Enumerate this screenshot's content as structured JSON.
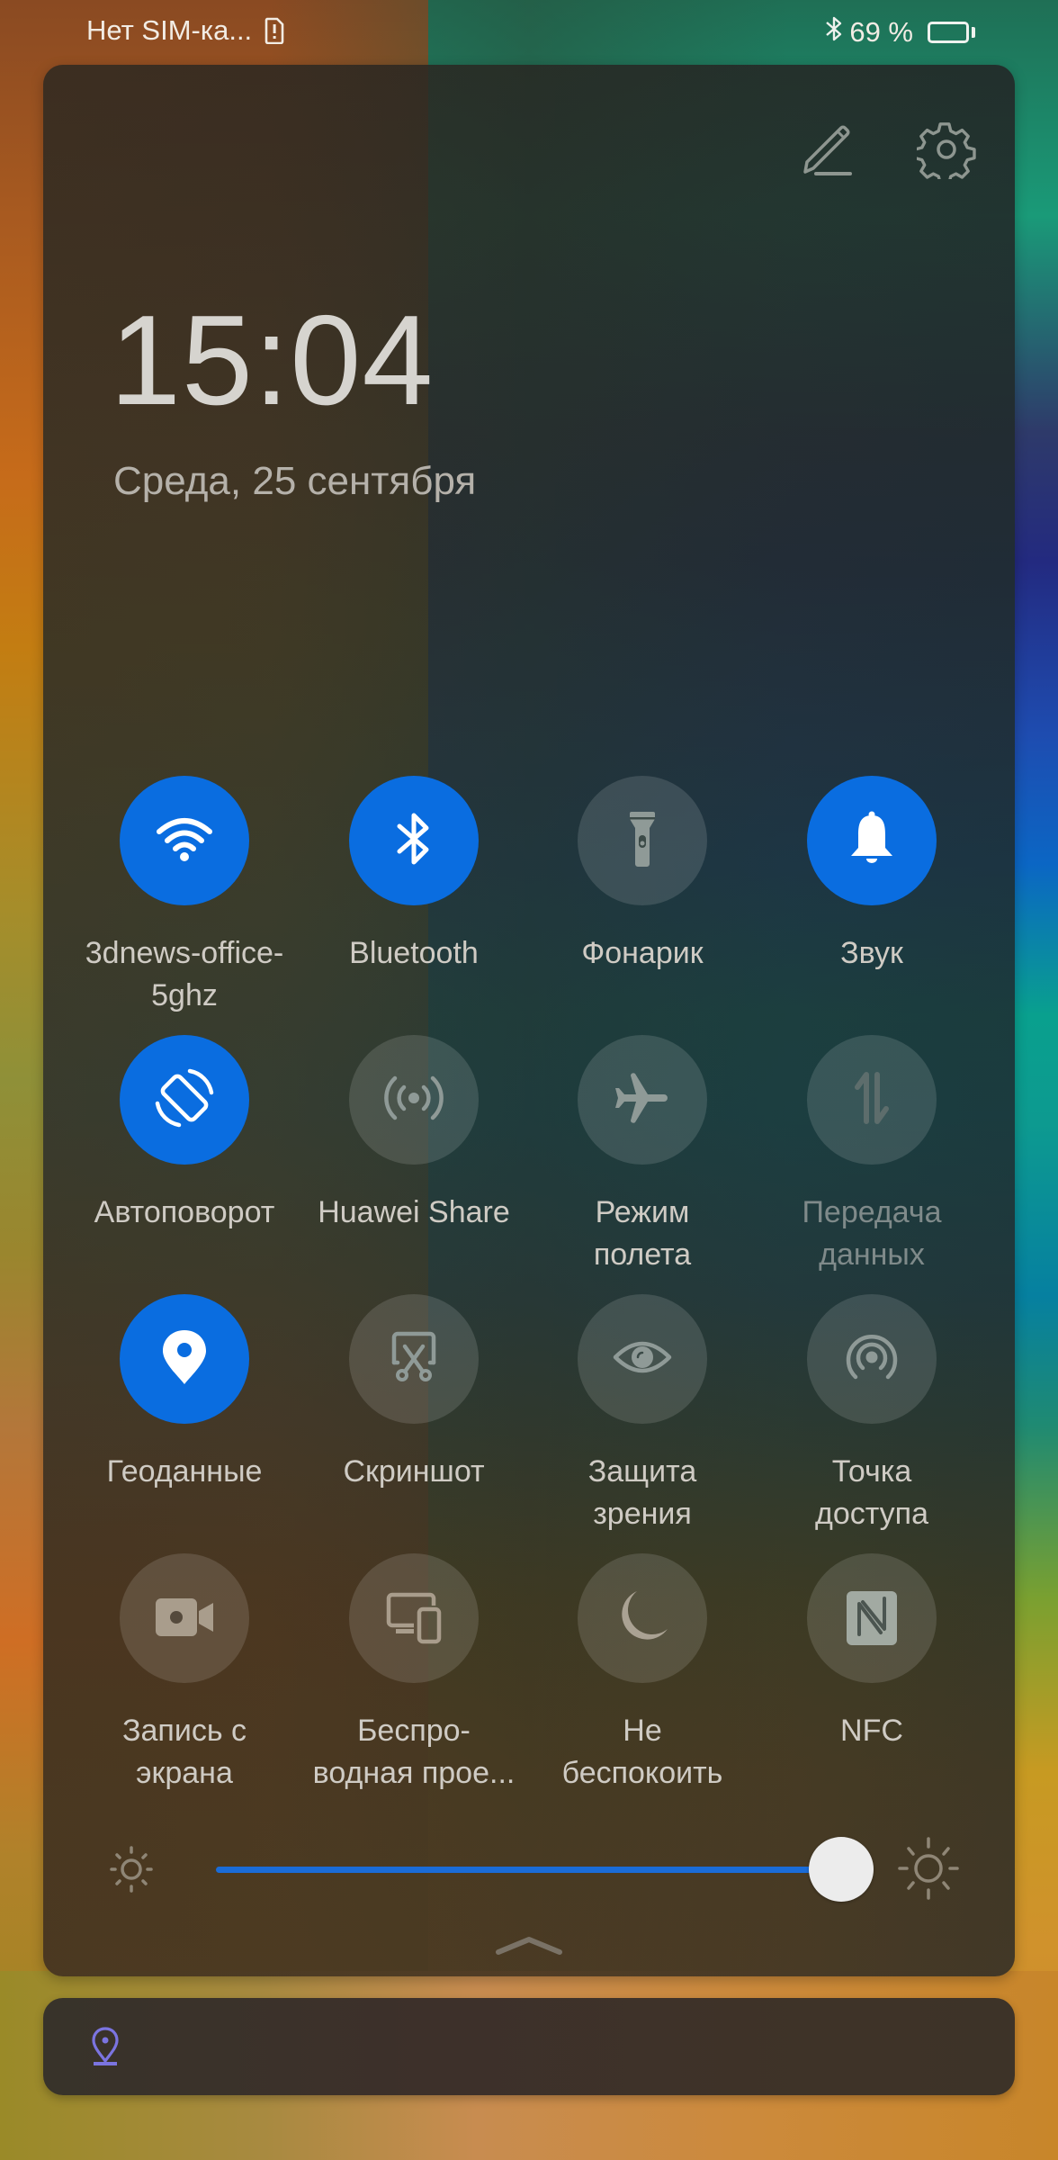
{
  "status_bar": {
    "carrier_text": "Нет SIM-ка...",
    "sim_icon": "sim-alert-icon",
    "bluetooth_icon": "bluetooth-icon",
    "battery_percent_text": "69 %",
    "battery_level": 0.69
  },
  "header": {
    "edit_icon": "pencil-edit-icon",
    "settings_icon": "gear-icon"
  },
  "clock": {
    "time": "15:04",
    "date": "Среда, 25 сентября"
  },
  "tiles": [
    {
      "label": "3dnews-office-\n5ghz",
      "icon": "wifi-icon",
      "state": "on"
    },
    {
      "label": "Bluetooth",
      "icon": "bluetooth-icon",
      "state": "on"
    },
    {
      "label": "Фонарик",
      "icon": "flashlight-icon",
      "state": "off"
    },
    {
      "label": "Звук",
      "icon": "bell-icon",
      "state": "on"
    },
    {
      "label": "Автоповорот",
      "icon": "auto-rotate-icon",
      "state": "on"
    },
    {
      "label": "Huawei Share",
      "icon": "huawei-share-icon",
      "state": "off"
    },
    {
      "label": "Режим\nполета",
      "icon": "airplane-icon",
      "state": "off"
    },
    {
      "label": "Передача\nданных",
      "icon": "mobile-data-icon",
      "state": "disabled"
    },
    {
      "label": "Геоданные",
      "icon": "location-icon",
      "state": "on"
    },
    {
      "label": "Скриншот",
      "icon": "screenshot-icon",
      "state": "off"
    },
    {
      "label": "Защита\nзрения",
      "icon": "eye-comfort-icon",
      "state": "off"
    },
    {
      "label": "Точка\nдоступа",
      "icon": "hotspot-icon",
      "state": "off"
    },
    {
      "label": "Запись с\nэкрана",
      "icon": "screen-record-icon",
      "state": "off"
    },
    {
      "label": "Беспро-\nводная прое...",
      "icon": "wireless-projection-icon",
      "state": "off"
    },
    {
      "label": "Не\nбеспокоить",
      "icon": "moon-icon",
      "state": "off"
    },
    {
      "label": "NFC",
      "icon": "nfc-icon",
      "state": "off"
    }
  ],
  "brightness": {
    "level": 1.0,
    "min_icon": "brightness-low-icon",
    "max_icon": "brightness-high-icon"
  },
  "collapse_icon": "chevron-up-icon",
  "notification": {
    "icon": "location-pin-icon",
    "icon_color": "#7b74e0"
  },
  "colors": {
    "accent": "#0a6de0",
    "slider": "#1a6cd8"
  }
}
